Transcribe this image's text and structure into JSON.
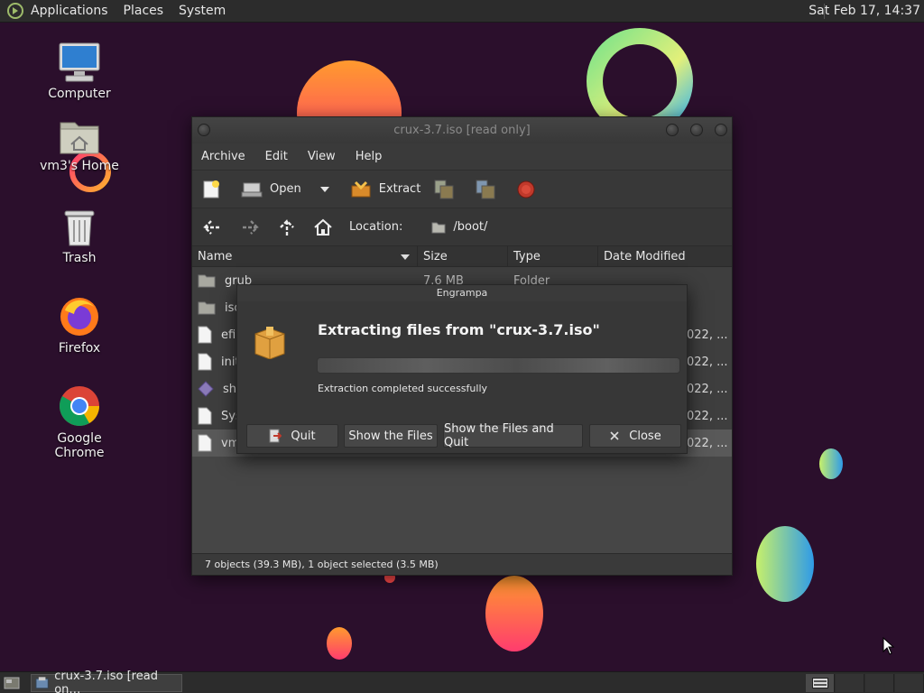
{
  "top_panel": {
    "menus": [
      "Applications",
      "Places",
      "System"
    ],
    "clock": "Sat Feb 17, 14:37"
  },
  "desktop": {
    "icons": [
      {
        "label": "Computer",
        "icon": "computer-icon"
      },
      {
        "label": "vm3's Home",
        "icon": "home-folder-icon"
      },
      {
        "label": "Trash",
        "icon": "trash-icon"
      },
      {
        "label": "Firefox",
        "icon": "firefox-icon"
      },
      {
        "label": "Google Chrome",
        "icon": "chrome-icon"
      }
    ]
  },
  "window": {
    "title": "crux-3.7.iso [read only]",
    "menubar": [
      "Archive",
      "Edit",
      "View",
      "Help"
    ],
    "toolbar": {
      "open_label": "Open",
      "extract_label": "Extract"
    },
    "location": {
      "label": "Location:",
      "path": "/boot/"
    },
    "columns": [
      "Name",
      "Size",
      "Type",
      "Date Modified"
    ],
    "rows": [
      {
        "name": "grub",
        "size": "7.6 MB",
        "type": "Folder",
        "date": ""
      },
      {
        "name": "iso",
        "size": "",
        "type": "",
        "date": ""
      },
      {
        "name": "efi",
        "size": "",
        "type": "",
        "date": "022, ..."
      },
      {
        "name": "init",
        "size": "",
        "type": "",
        "date": "022, ..."
      },
      {
        "name": "she",
        "size": "",
        "type": "",
        "date": "022, ..."
      },
      {
        "name": "Sys",
        "size": "",
        "type": "",
        "date": "022, ..."
      },
      {
        "name": "vm",
        "size": "",
        "type": "",
        "date": "022, ..."
      }
    ],
    "statusbar": "7 objects (39.3 MB), 1 object selected (3.5 MB)"
  },
  "dialog": {
    "title": "Engrampa",
    "heading": "Extracting files from \"crux-3.7.iso\"",
    "status": "Extraction completed successfully",
    "progress": 1.0,
    "buttons": {
      "quit": "Quit",
      "show_files": "Show the Files",
      "show_files_quit": "Show the Files and Quit",
      "close": "Close"
    }
  },
  "taskbar": {
    "task_label": "crux-3.7.iso [read on…"
  },
  "colors": {
    "panel": "#2c2c2c",
    "window_bg": "#3c3c3c",
    "desktop_bg": "#2a0d2a",
    "close_icon_red": "#c0392b"
  }
}
